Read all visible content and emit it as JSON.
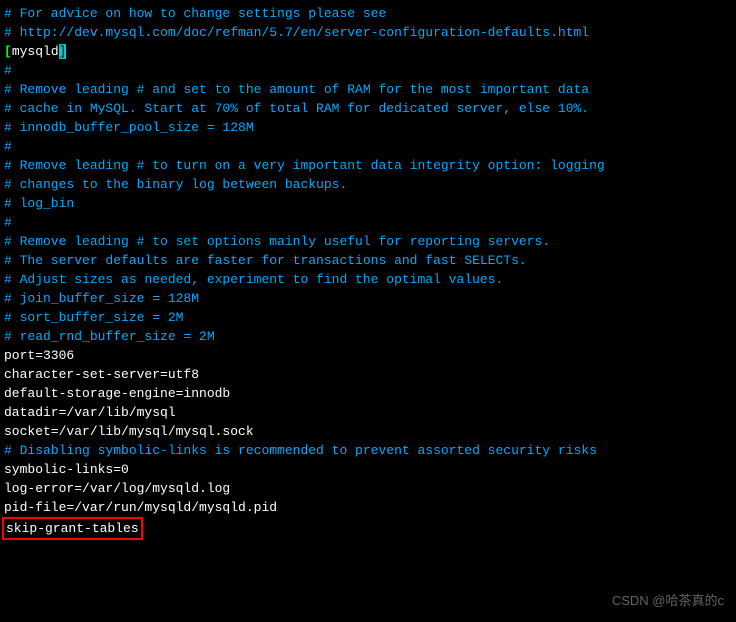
{
  "lines": {
    "l01": "# For advice on how to change settings please see",
    "l02": "# http://dev.mysql.com/doc/refman/5.7/en/server-configuration-defaults.html",
    "l03": "",
    "l04_bracket_open": "[",
    "l04_section": "mysqld",
    "l04_bracket_close": "]",
    "l05": "#",
    "l06": "# Remove leading # and set to the amount of RAM for the most important data",
    "l07": "# cache in MySQL. Start at 70% of total RAM for dedicated server, else 10%.",
    "l08": "# innodb_buffer_pool_size = 128M",
    "l09": "#",
    "l10": "# Remove leading # to turn on a very important data integrity option: logging",
    "l11": "# changes to the binary log between backups.",
    "l12": "# log_bin",
    "l13": "#",
    "l14": "# Remove leading # to set options mainly useful for reporting servers.",
    "l15": "# The server defaults are faster for transactions and fast SELECTs.",
    "l16": "# Adjust sizes as needed, experiment to find the optimal values.",
    "l17": "# join_buffer_size = 128M",
    "l18": "# sort_buffer_size = 2M",
    "l19": "# read_rnd_buffer_size = 2M",
    "l20": "port=3306",
    "l21": "character-set-server=utf8",
    "l22": "default-storage-engine=innodb",
    "l23": "",
    "l24": "datadir=/var/lib/mysql",
    "l25": "socket=/var/lib/mysql/mysql.sock",
    "l26": "",
    "l27": "# Disabling symbolic-links is recommended to prevent assorted security risks",
    "l28": "symbolic-links=0",
    "l29": "",
    "l30": "log-error=/var/log/mysqld.log",
    "l31": "pid-file=/var/run/mysqld/mysqld.pid",
    "l32": "skip-grant-tables"
  },
  "watermark": "CSDN @哈茶真的c"
}
